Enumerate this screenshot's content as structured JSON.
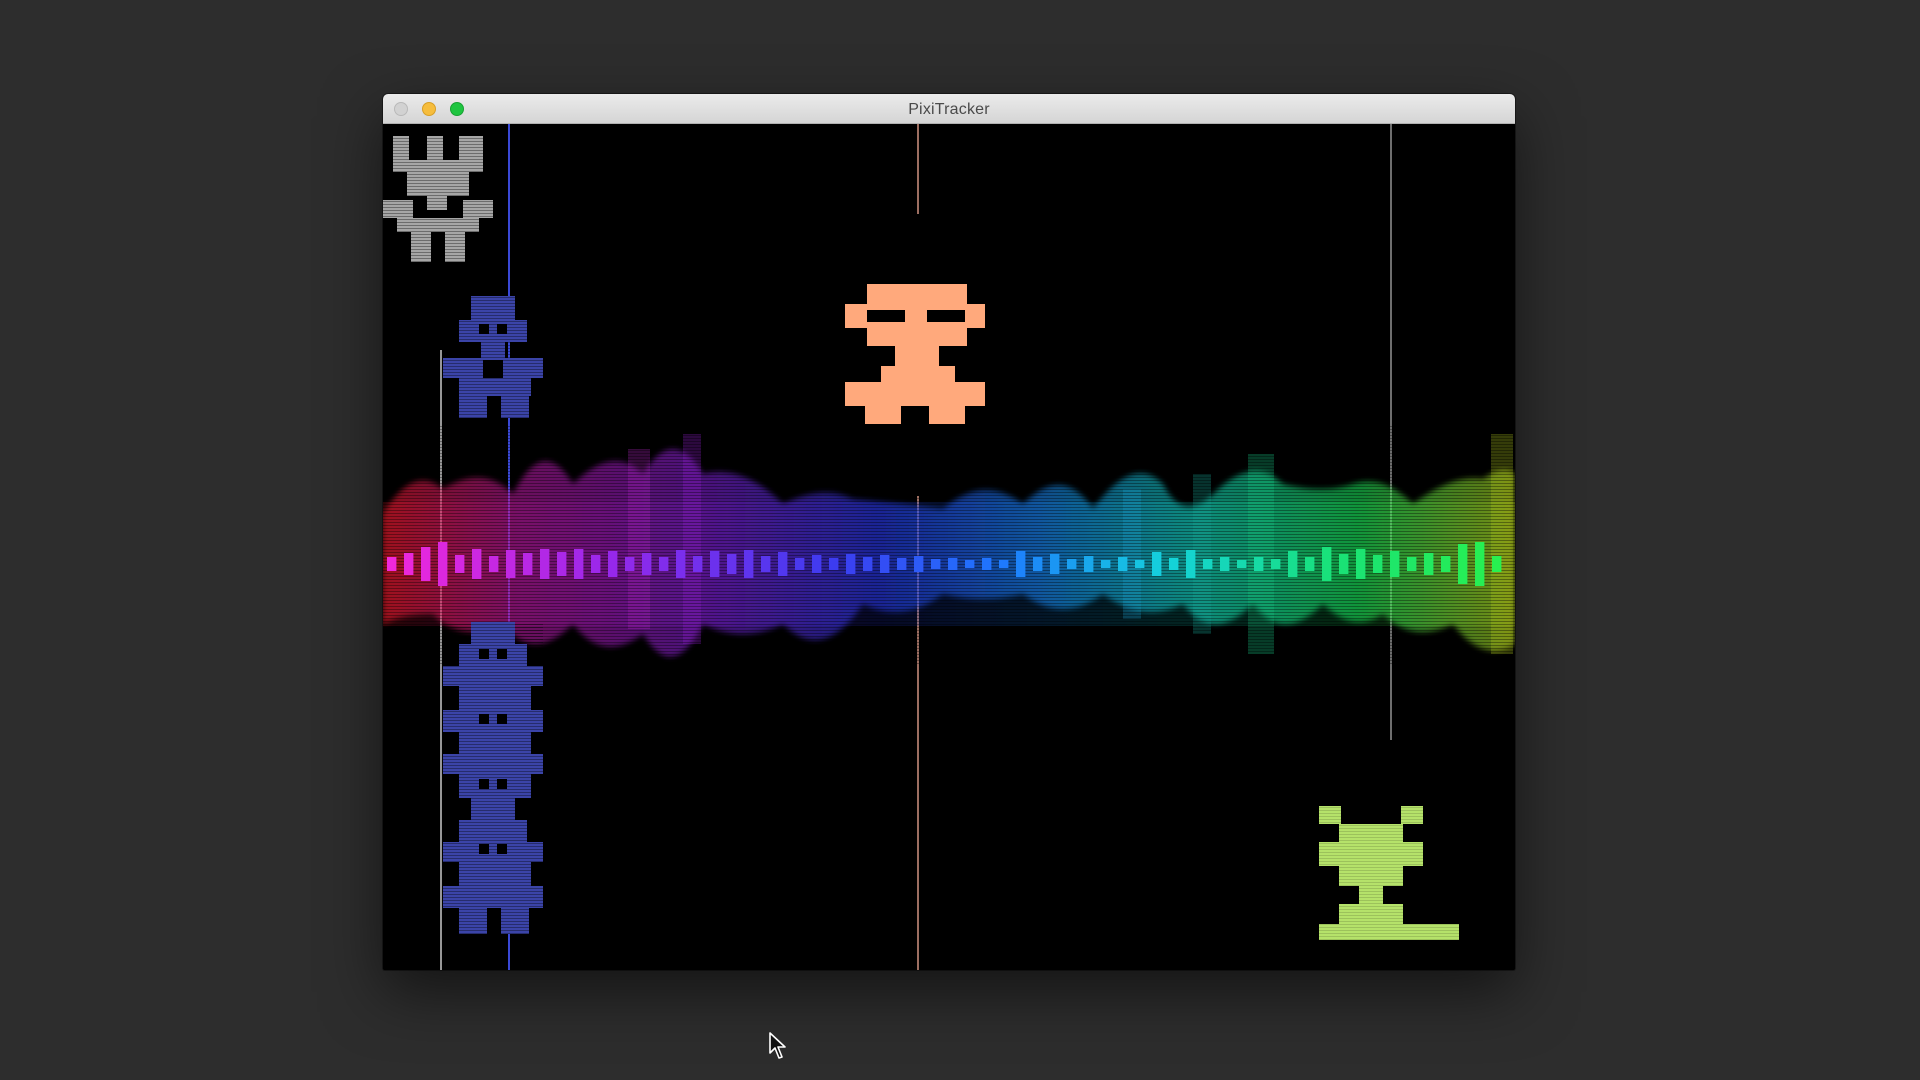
{
  "window": {
    "title": "PixiTracker"
  },
  "colors": {
    "desktop": "#2d2d2d",
    "stage": "#000000",
    "sprite_gray": "#a6a6a6",
    "sprite_blue": "#3b44a8",
    "sprite_orange": "#ffa97c",
    "sprite_green": "#b5e26a",
    "line_blue": "#3a49d6",
    "line_white": "#bdbdbd",
    "line_pink": "#c48a7a",
    "line_gray": "#8a8a8a"
  },
  "visualizer": {
    "bars": [
      14,
      22,
      34,
      44,
      18,
      30,
      16,
      28,
      22,
      30,
      24,
      30,
      18,
      26,
      14,
      22,
      14,
      28,
      16,
      26,
      20,
      28,
      16,
      24,
      12,
      18,
      12,
      20,
      14,
      18,
      12,
      16,
      10,
      12,
      8,
      12,
      8,
      26,
      14,
      20,
      10,
      16,
      8,
      14,
      8,
      24,
      12,
      28,
      10,
      14,
      8,
      14,
      10,
      26,
      14,
      34,
      20,
      30,
      18,
      26,
      14,
      22,
      16,
      40,
      44,
      16
    ]
  },
  "icons": {
    "cursor": "arrow-cursor-icon"
  }
}
